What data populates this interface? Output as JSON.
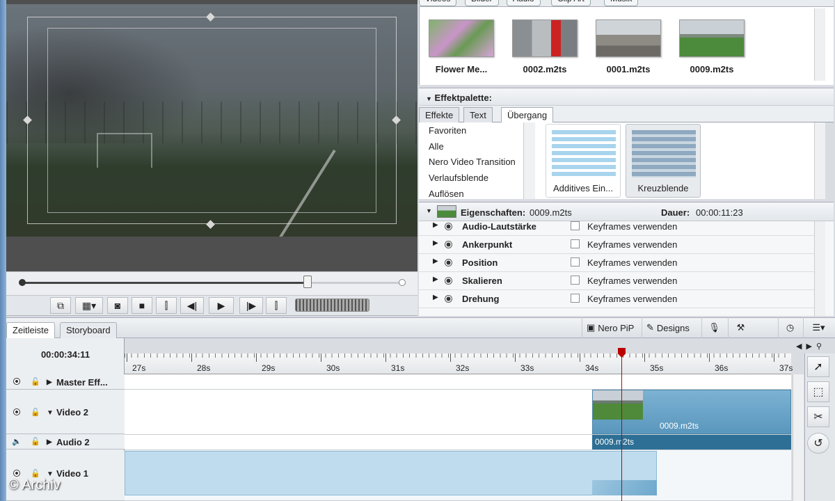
{
  "media": {
    "tabs": [
      "Videos",
      "Bilder",
      "Audio",
      "Clip Art",
      "Musik"
    ],
    "items": [
      {
        "label": "Flower Me..."
      },
      {
        "label": "0002.m2ts"
      },
      {
        "label": "0001.m2ts"
      },
      {
        "label": "0009.m2ts"
      }
    ]
  },
  "effects": {
    "title": "Effektpalette:",
    "tabs": [
      "Effekte",
      "Text",
      "Übergang"
    ],
    "categories": [
      "Favoriten",
      "Alle",
      "Nero Video Transition",
      "Verlaufsblende",
      "Auflösen"
    ],
    "tiles": [
      {
        "label": "Additives Ein..."
      },
      {
        "label": "Kreuzblende"
      }
    ]
  },
  "properties": {
    "title_label": "Eigenschaften:",
    "title_value": "0009.m2ts",
    "duration_label": "Dauer:",
    "duration_value": "00:00:11:23",
    "rows": [
      {
        "name": "Audio-Lautstärke",
        "kf": "Keyframes verwenden"
      },
      {
        "name": "Ankerpunkt",
        "kf": "Keyframes verwenden"
      },
      {
        "name": "Position",
        "kf": "Keyframes verwenden"
      },
      {
        "name": "Skalieren",
        "kf": "Keyframes verwenden"
      },
      {
        "name": "Drehung",
        "kf": "Keyframes verwenden"
      }
    ]
  },
  "timeline": {
    "tabs": [
      "Zeitleiste",
      "Storyboard"
    ],
    "toolbar": {
      "pip": "Nero PiP",
      "designs": "Designs"
    },
    "timecode": "00:00:34:11",
    "ruler": [
      "27s",
      "28s",
      "29s",
      "30s",
      "31s",
      "32s",
      "33s",
      "34s",
      "35s",
      "36s",
      "37s"
    ],
    "tracks": [
      {
        "name": "Master Eff..."
      },
      {
        "name": "Video 2"
      },
      {
        "name": "Audio 2"
      },
      {
        "name": "Video 1"
      }
    ],
    "clips": {
      "video2": "0009.m2ts",
      "audio2": "0009.m2ts"
    }
  },
  "scrubber": {
    "position": 0.75
  },
  "watermark": "© Archiv"
}
